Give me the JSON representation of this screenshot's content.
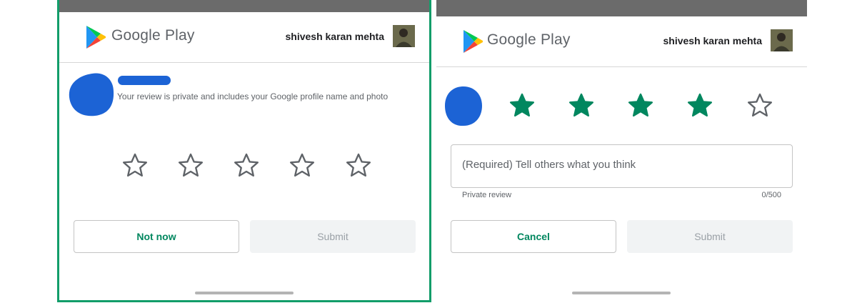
{
  "brand_name": "Google Play",
  "user_name": "shivesh karan mehta",
  "colors": {
    "accent_green": "#01875f",
    "frame_green": "#129d6a",
    "redaction_blue": "#1c63d5",
    "star_outline": "#5f6368"
  },
  "left_panel": {
    "private_note": "Your review is private and includes your Google profile name and photo",
    "rating": 0,
    "max_rating": 5,
    "not_now_label": "Not now",
    "submit_label": "Submit"
  },
  "right_panel": {
    "rating": 4,
    "max_rating": 5,
    "review_placeholder": "(Required) Tell others what you think",
    "private_review_label": "Private review",
    "char_count": "0/500",
    "cancel_label": "Cancel",
    "submit_label": "Submit"
  },
  "icons": {
    "logo": "google-play-logo",
    "avatar": "profile-photo",
    "star_empty": "star-outline-icon",
    "star_filled": "star-filled-icon"
  }
}
